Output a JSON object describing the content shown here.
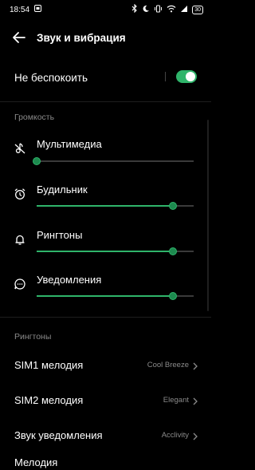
{
  "status": {
    "time": "18:54",
    "battery": "30"
  },
  "app_bar": {
    "title": "Звук и вибрация"
  },
  "dnd": {
    "label": "Не беспокоить",
    "enabled": true
  },
  "volume": {
    "section_label": "Громкость",
    "items": [
      {
        "label": "Мультимедиа",
        "icon": "media-muted-icon",
        "level": 0.0
      },
      {
        "label": "Будильник",
        "icon": "alarm-icon",
        "level": 0.87
      },
      {
        "label": "Рингтоны",
        "icon": "bell-icon",
        "level": 0.87
      },
      {
        "label": "Уведомления",
        "icon": "chat-bubble-icon",
        "level": 0.87
      }
    ]
  },
  "ringtones": {
    "section_label": "Рингтоны",
    "items": [
      {
        "label": "SIM1 мелодия",
        "value": "Cool Breeze"
      },
      {
        "label": "SIM2 мелодия",
        "value": "Elegant"
      },
      {
        "label": "Звук уведомления",
        "value": "Acclivity"
      },
      {
        "label": "Мелодия",
        "value": ""
      }
    ]
  },
  "colors": {
    "accent": "#2fb46a",
    "background": "#000000",
    "secondary_text": "#8a8a8a"
  }
}
